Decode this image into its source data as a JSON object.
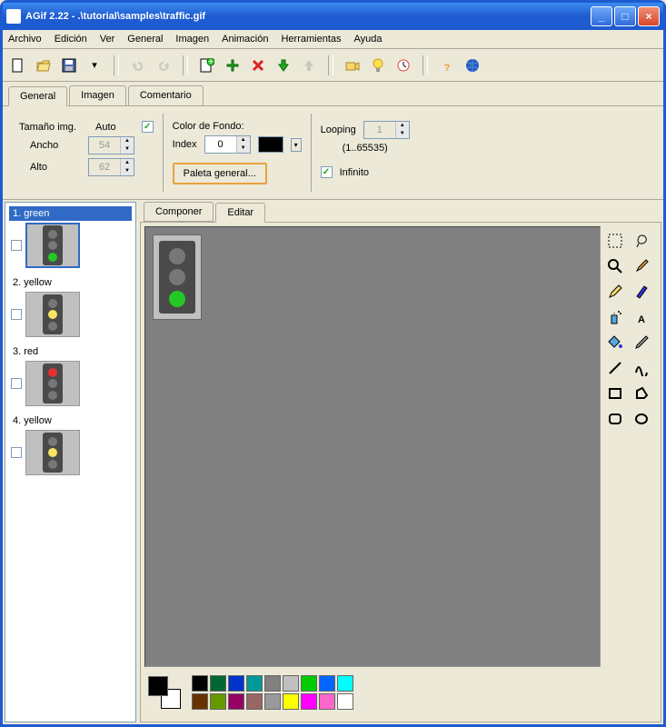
{
  "title": "AGif 2.22 - .\\tutorial\\samples\\traffic.gif",
  "menu": [
    "Archivo",
    "Edición",
    "Ver",
    "General",
    "Imagen",
    "Animación",
    "Herramientas",
    "Ayuda"
  ],
  "tabs": {
    "items": [
      "General",
      "Imagen",
      "Comentario"
    ],
    "active": 0
  },
  "general": {
    "size_label": "Tamaño img.",
    "auto_label": "Auto",
    "auto_checked": true,
    "width_label": "Ancho",
    "width_value": "54",
    "height_label": "Alto",
    "height_value": "62",
    "bgcolor_label": "Color de Fondo:",
    "index_label": "Index",
    "index_value": "0",
    "palette_btn": "Paleta general...",
    "looping_label": "Looping",
    "looping_value": "1",
    "looping_range": "(1..65535)",
    "infinite_label": "Infinito",
    "infinite_checked": true
  },
  "frames": [
    {
      "label": "1. green",
      "light": "g",
      "selected": true
    },
    {
      "label": "2. yellow",
      "light": "y",
      "selected": false
    },
    {
      "label": "3. red",
      "light": "r",
      "selected": false
    },
    {
      "label": "4. yellow",
      "light": "y",
      "selected": false
    }
  ],
  "editor_tabs": {
    "items": [
      "Componer",
      "Editar"
    ],
    "active": 1
  },
  "canvas_frame": {
    "light": "g"
  },
  "palette_colors_row1": [
    "#000000",
    "#006633",
    "#0033cc",
    "#009999",
    "#808080",
    "#c0c0c0",
    "#00cc00",
    "#0066ff",
    "#00ffff"
  ],
  "palette_colors_row2": [
    "#663300",
    "#669900",
    "#990066",
    "#996666",
    "#999999",
    "#ffff00",
    "#ff00ff",
    "#ff66cc",
    "#ffffff"
  ]
}
